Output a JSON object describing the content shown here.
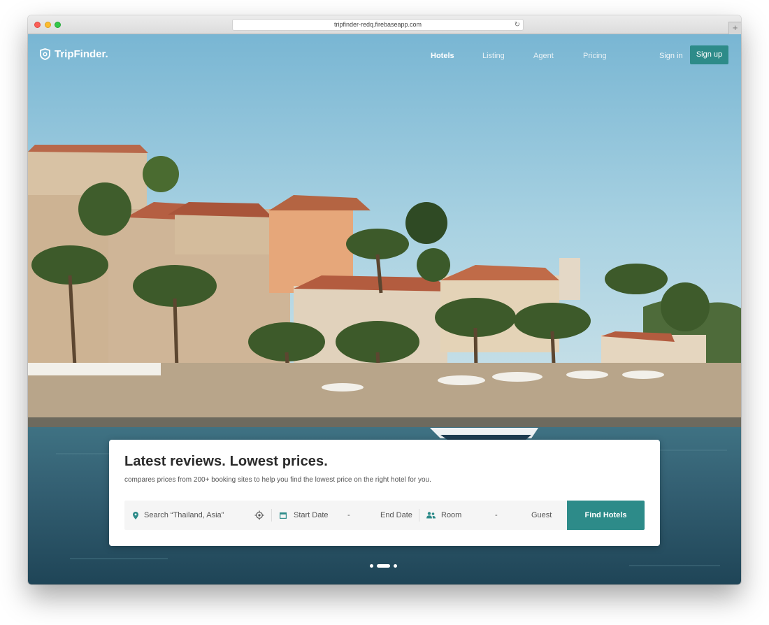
{
  "browser": {
    "url": "tripfinder-redq.firebaseapp.com"
  },
  "nav": {
    "logo_text": "TripFinder.",
    "links": [
      "Hotels",
      "Listing",
      "Agent",
      "Pricing"
    ],
    "active_link": "Hotels",
    "sign_in": "Sign in",
    "sign_up": "Sign up"
  },
  "search": {
    "title": "Latest reviews. Lowest prices.",
    "subtitle": "compares prices from 200+ booking sites to help you find the lowest price on the right hotel for you.",
    "location_placeholder": "Search “Thailand, Asia”",
    "start_date": "Start Date",
    "date_separator": "-",
    "end_date": "End Date",
    "room": "Room",
    "guest_separator": "-",
    "guest": "Guest",
    "button": "Find Hotels"
  },
  "carousel": {
    "slide_count": 3,
    "active_slide": 2
  },
  "colors": {
    "accent": "#2d8b89",
    "sky": "#8fc3d9",
    "sea": "#3a6a7c"
  },
  "icons": {
    "logo": "shield-logo-icon",
    "location": "map-pin-icon",
    "locate": "crosshair-icon",
    "calendar": "calendar-icon",
    "guests": "people-icon",
    "reload": "reload-icon",
    "new_tab": "plus-icon"
  }
}
